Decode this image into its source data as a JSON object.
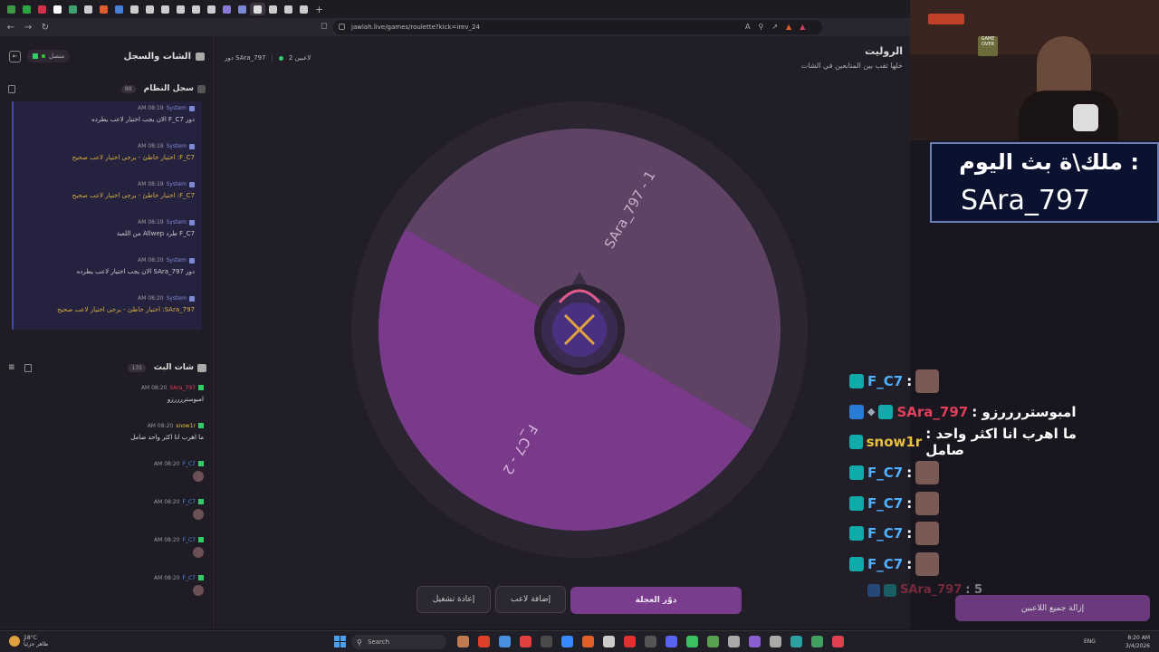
{
  "browser": {
    "url": "jawlah.live/games/roulette?kick=irev_24",
    "tab_colors": [
      "#3c9b44",
      "#2aa640",
      "#d0304a",
      "#ffffff",
      "#3fa070",
      "#cccccc",
      "#e05a2a",
      "#4a7fd6",
      "#cccccc",
      "#cccccc",
      "#cccccc",
      "#cccccc",
      "#cccccc",
      "#cccccc",
      "#8a7ad6",
      "#7a8ad6",
      "#dddddd",
      "#cccccc",
      "#cccccc",
      "#cccccc"
    ]
  },
  "left_panel": {
    "title": "الشات والسجل",
    "status": "متصل",
    "system_log": {
      "title": "سجل النظام",
      "count": "88",
      "messages": [
        {
          "sender": "System",
          "time": "08:19 AM",
          "text": "دور F_C7 الان يجب اختيار لاعب يطرده",
          "warn": false
        },
        {
          "sender": "System",
          "time": "08:19 AM",
          "text": "F_C7: اختيار خاطئ - يرجى اختيار لاعب صحيح",
          "warn": true
        },
        {
          "sender": "System",
          "time": "08:19 AM",
          "text": "F_C7: اختيار خاطئ - يرجى اختيار لاعب صحيح",
          "warn": true
        },
        {
          "sender": "System",
          "time": "08:19 AM",
          "text": "F_C7 طرد Allwep من اللعبة",
          "warn": false
        },
        {
          "sender": "System",
          "time": "08:20 AM",
          "text": "دور SAra_797 الان يجب اختيار لاعب يطرده",
          "warn": false
        },
        {
          "sender": "System",
          "time": "08:20 AM",
          "text": "SAra_797: اختيار خاطئ - يرجى اختيار لاعب صحيح",
          "warn": true
        }
      ]
    },
    "live_chat": {
      "title": "شات البث",
      "count": "135",
      "messages": [
        {
          "user": "SAra_797",
          "color": "#e0405a",
          "time": "08:20 AM",
          "text": "امبوستررررزو",
          "avatar": false
        },
        {
          "user": "snow1r",
          "color": "#e0c040",
          "time": "08:20 AM",
          "text": "ما اهرب انا اكثر واحد صامل",
          "avatar": false
        },
        {
          "user": "F_C7",
          "color": "#4a90e0",
          "time": "08:20 AM",
          "text": "",
          "avatar": true
        },
        {
          "user": "F_C7",
          "color": "#4a90e0",
          "time": "08:20 AM",
          "text": "",
          "avatar": true
        },
        {
          "user": "F_C7",
          "color": "#4a90e0",
          "time": "08:20 AM",
          "text": "",
          "avatar": true
        },
        {
          "user": "F_C7",
          "color": "#4a90e0",
          "time": "08:20 AM",
          "text": "",
          "avatar": true
        }
      ]
    }
  },
  "game": {
    "title": "الروليت",
    "subtitle": "خلها تقب بين المتابعين في الشات",
    "players_count": "2 لاعبين",
    "turn": "دور SAra_797",
    "wheel": {
      "segments": [
        {
          "label": "SAra_797 - 1",
          "color": "#5e4365"
        },
        {
          "label": "F_C7 - 2",
          "color": "#7a3a8a"
        }
      ]
    },
    "buttons": {
      "spin": "دوّر العجلة",
      "add_player": "إضافة لاعب",
      "restart": "إعادة تشغيل"
    }
  },
  "overlay": {
    "banner_line1": "ملك\\ة بث اليوم :",
    "banner_line2": "SAra_797",
    "chat": [
      {
        "user": "F_C7",
        "color": "#4fb0ff",
        "text": ":",
        "avatar": true,
        "extra": false
      },
      {
        "user": "SAra_797",
        "color": "#e0405a",
        "text": ": امبوستررررزو",
        "avatar": false,
        "extra": true
      },
      {
        "user": "snow1r",
        "color": "#e8c040",
        "text": ": ما اهرب انا اكثر واحد صامل",
        "avatar": false,
        "extra": false
      },
      {
        "user": "F_C7",
        "color": "#4fb0ff",
        "text": ":",
        "avatar": true,
        "extra": false
      },
      {
        "user": "F_C7",
        "color": "#4fb0ff",
        "text": ":",
        "avatar": true,
        "extra": false
      },
      {
        "user": "F_C7",
        "color": "#4fb0ff",
        "text": ":",
        "avatar": true,
        "extra": false
      },
      {
        "user": "F_C7",
        "color": "#4fb0ff",
        "text": ":",
        "avatar": true,
        "extra": false
      }
    ],
    "last_row_user": "SAra_797",
    "last_row_text": ": 5",
    "remove_all": "إزالة جميع اللاعبين"
  },
  "taskbar": {
    "weather_temp": "18°C",
    "weather_text": "ظاهر جزئياً",
    "search": "Search",
    "lang": "ENG",
    "time": "8:20 AM",
    "date": "3/4/2026",
    "icon_colors": [
      "#c07a50",
      "#e0402a",
      "#4a90e0",
      "#e04040",
      "#4a4a4a",
      "#3a8aff",
      "#e0602a",
      "#cccccc",
      "#e03030",
      "#555555",
      "#5865f2",
      "#3ac060",
      "#58a050",
      "#aaaaaa",
      "#8a60d0",
      "#aaaaaa",
      "#2aa0a0",
      "#40a060",
      "#e04050"
    ]
  }
}
